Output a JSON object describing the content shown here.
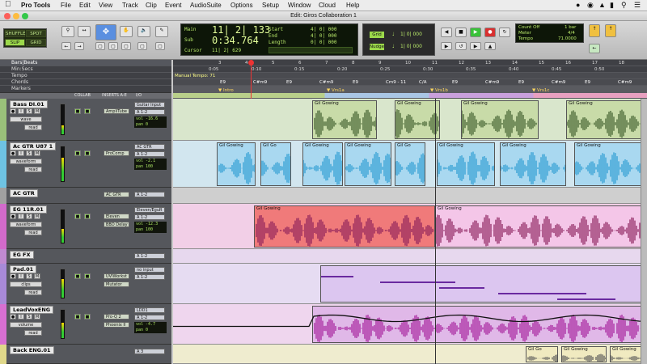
{
  "menu": {
    "app": "Pro Tools",
    "items": [
      "File",
      "Edit",
      "View",
      "Track",
      "Clip",
      "Event",
      "AudioSuite",
      "Options",
      "Setup",
      "Window",
      "Cloud",
      "Help"
    ]
  },
  "window_title": "Edit: Giros Collaboration 1",
  "toolbar": {
    "modes": [
      "SHUFFLE",
      "SPOT",
      "SLIP",
      "GRID"
    ],
    "counter_main": "11| 2| 133",
    "counter_sub": "0:34.764",
    "label_main": "Main",
    "label_sub": "Sub",
    "label_cursor": "Cursor",
    "cursor_val": "11| 2| 629",
    "start_label": "Start",
    "end_label": "End",
    "length_label": "Length",
    "start_val": "4| 0| 000",
    "end_val": "4| 0| 000",
    "length_val": "0| 0| 000",
    "grid_label": "Grid",
    "grid_val": "1| 0| 000",
    "nudge_label": "Nudge",
    "nudge_val": "1| 0| 000",
    "countoff": "Count Off",
    "countoff_val": "1 bar",
    "meter": "Meter",
    "meter_val": "4/4",
    "tempo": "Tempo",
    "tempo_val": "71.0000"
  },
  "rulers": {
    "labels": [
      "Bars|Beats",
      "Min:Secs",
      "Tempo",
      "Chords",
      "Markers"
    ],
    "bars": [
      "3",
      "4",
      "5",
      "6",
      "7",
      "8",
      "9",
      "10",
      "11",
      "12",
      "13",
      "14",
      "15",
      "16",
      "17",
      "18"
    ],
    "secs": [
      "0:05",
      "0:10",
      "0:15",
      "0:20",
      "0:25",
      "0:30",
      "0:35",
      "0:40",
      "0:45",
      "0:50"
    ],
    "tempo_text": "Manual Tempo:  71",
    "chords": [
      "E9",
      "C#m9",
      "E9",
      "C#m9",
      "E9",
      "Cm9 - 11",
      "C/A",
      "E9",
      "C#m9",
      "E9",
      "C#m9",
      "E9",
      "C#m9",
      "E9"
    ],
    "markers": [
      "Intro",
      "Vrs1a",
      "Vrs1b",
      "Vrs1c"
    ]
  },
  "mix_headers": {
    "collab": "COLLAB",
    "inserts": "INSERTS A-E",
    "io": "I/O"
  },
  "tracks": [
    {
      "name": "Bass DI.01",
      "view": "wave",
      "mode": "read",
      "insert": "AmpliTube",
      "io": "Guitar Input",
      "out": "A 1-2",
      "vol": "-16.6",
      "pan": "0",
      "color": "#9ac17a"
    },
    {
      "name": "Ac GTR U87 1",
      "view": "waveform",
      "mode": "read",
      "insert": "ProComp",
      "io": "AC GTR",
      "out": "A 1-2",
      "vol": "-2.1",
      "pan": "100",
      "color": "#6ec3e3"
    },
    {
      "name": "AC GTR",
      "view": "",
      "mode": "",
      "insert": "AC GTR",
      "io": "A 1-2",
      "out": "",
      "vol": "",
      "pan": "",
      "color": "#a0a0a0"
    },
    {
      "name": "EG 11R.01",
      "view": "waveform",
      "mode": "read",
      "insert": "Eleven",
      "io": "Eleven/EguR",
      "out": "A 1-2",
      "vol": "-12.3",
      "pan": "100",
      "color": "#d26acb"
    },
    {
      "name": "EG FX",
      "view": "",
      "mode": "",
      "insert": "",
      "io": "eg fx",
      "out": "A 1-2",
      "vol": "",
      "pan": "",
      "color": "#c08ad0"
    },
    {
      "name": "Pad.01",
      "view": "clips",
      "mode": "read",
      "insert": "UVIWorkst",
      "io": "no input",
      "out": "A 1-2",
      "vol": "",
      "pan": "",
      "color": "#a88ad8"
    },
    {
      "name": "LeadVoxENG",
      "view": "volume",
      "mode": "read",
      "insert": "Pro-Q 2",
      "io": "LDD1",
      "out": "A 1-2",
      "vol": "-4.7",
      "pan": "0",
      "color": "#d86fd2"
    },
    {
      "name": "Back ENG.01",
      "view": "",
      "mode": "",
      "insert": "",
      "io": "A 3",
      "out": "",
      "vol": "",
      "pan": "",
      "color": "#e0d88a"
    }
  ],
  "clip_name": "Gil Gowing",
  "clip_name_short": "Gil Go",
  "inserts_extra": {
    "bbd": "BBD Delay",
    "mutator": "Mutator",
    "phoenix": "Phoenix II",
    "ac": "AC GTR"
  }
}
